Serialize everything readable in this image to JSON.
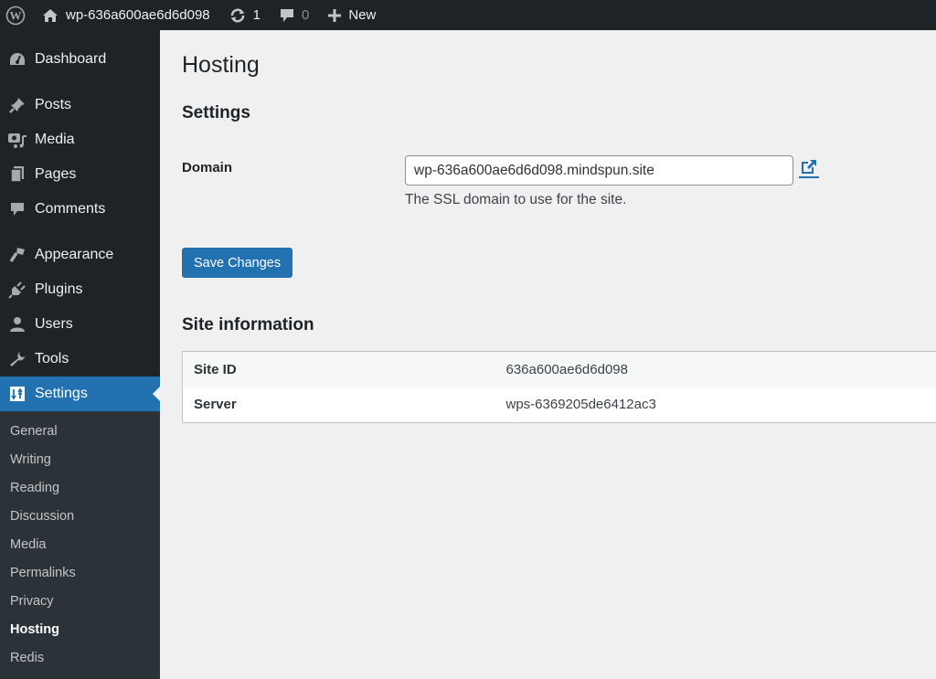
{
  "admin_bar": {
    "site_name": "wp-636a600ae6d6d098",
    "updates_count": "1",
    "comments_count": "0",
    "new_label": "New",
    "icons": [
      "wordpress-logo-icon",
      "home-icon",
      "updates-icon",
      "comment-icon",
      "plus-icon"
    ]
  },
  "sidebar": {
    "items": [
      {
        "label": "Dashboard",
        "icon": "dashboard-icon"
      },
      {
        "label": "Posts",
        "icon": "pin-icon"
      },
      {
        "label": "Media",
        "icon": "media-icon"
      },
      {
        "label": "Pages",
        "icon": "pages-icon"
      },
      {
        "label": "Comments",
        "icon": "comment-icon"
      },
      {
        "label": "Appearance",
        "icon": "paintbrush-icon"
      },
      {
        "label": "Plugins",
        "icon": "plug-icon"
      },
      {
        "label": "Users",
        "icon": "user-icon"
      },
      {
        "label": "Tools",
        "icon": "wrench-icon"
      },
      {
        "label": "Settings",
        "icon": "settings-icon",
        "current": true
      }
    ],
    "submenu": [
      {
        "label": "General"
      },
      {
        "label": "Writing"
      },
      {
        "label": "Reading"
      },
      {
        "label": "Discussion"
      },
      {
        "label": "Media"
      },
      {
        "label": "Permalinks"
      },
      {
        "label": "Privacy"
      },
      {
        "label": "Hosting",
        "current": true
      },
      {
        "label": "Redis"
      }
    ]
  },
  "page": {
    "title": "Hosting",
    "settings_heading": "Settings",
    "domain_label": "Domain",
    "domain_value": "wp-636a600ae6d6d098.mindspun.site",
    "domain_description": "The SSL domain to use for the site.",
    "save_label": "Save Changes",
    "site_info_heading": "Site information",
    "site_info": [
      {
        "key": "Site ID",
        "value": "636a600ae6d6d098"
      },
      {
        "key": "Server",
        "value": "wps-6369205de6412ac3"
      }
    ]
  },
  "colors": {
    "accent": "#2271b1",
    "admin_bar_bg": "#1d2327",
    "submenu_bg": "#2c3338",
    "page_bg": "#f0f0f1"
  }
}
